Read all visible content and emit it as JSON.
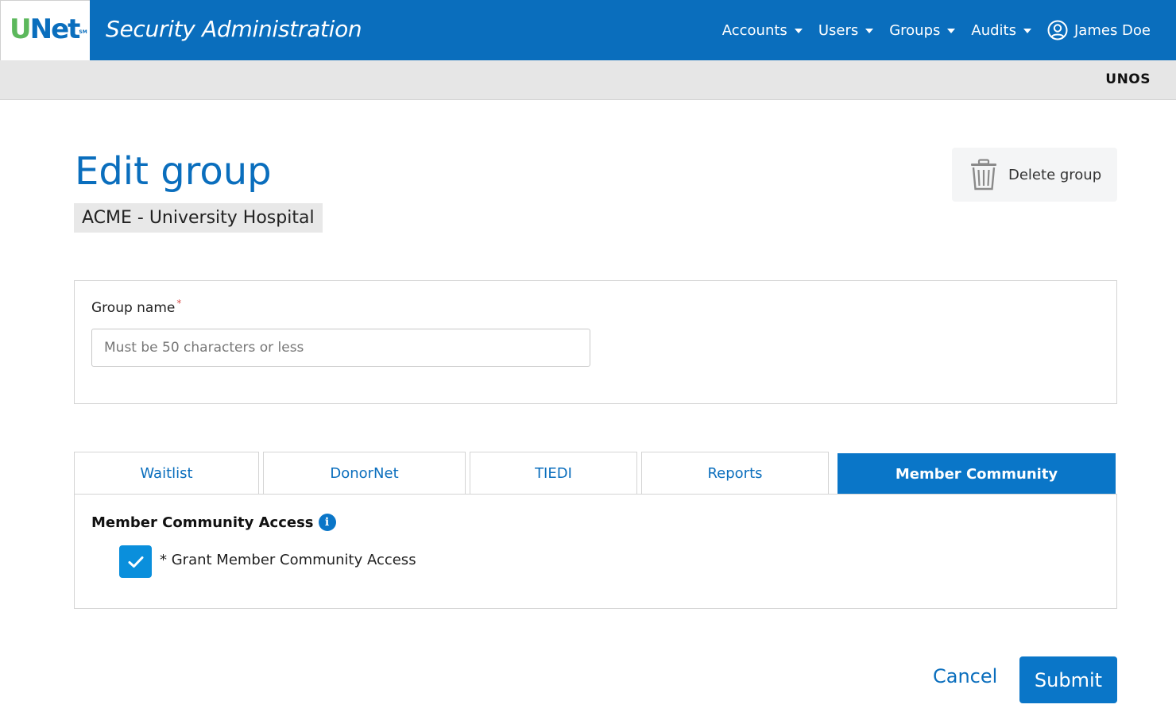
{
  "header": {
    "logo_u": "U",
    "logo_net": "Net",
    "logo_tm": "SM",
    "app_title": "Security Administration",
    "nav": [
      {
        "label": "Accounts"
      },
      {
        "label": "Users"
      },
      {
        "label": "Groups"
      },
      {
        "label": "Audits"
      }
    ],
    "user_name": "James Doe",
    "user_icon": "user-circle-icon"
  },
  "orgbar": {
    "org_name": "UNOS"
  },
  "page": {
    "title": "Edit group",
    "subtitle": "ACME - University Hospital",
    "delete_label": "Delete group",
    "delete_icon": "trash-icon"
  },
  "form": {
    "group_name_label": "Group name",
    "required_marker": "*",
    "group_name_value": "",
    "group_name_placeholder": "Must be 50 characters or less"
  },
  "tabs": [
    {
      "label": "Waitlist",
      "active": false
    },
    {
      "label": "DonorNet",
      "active": false
    },
    {
      "label": "TIEDI",
      "active": false
    },
    {
      "label": "Reports",
      "active": false
    },
    {
      "label": "Member Community",
      "active": true
    }
  ],
  "tab_panel": {
    "heading": "Member Community Access",
    "info_icon": "i",
    "checkbox_checked": true,
    "checkbox_label": "* Grant Member Community Access"
  },
  "footer": {
    "cancel_label": "Cancel",
    "submit_label": "Submit"
  },
  "colors": {
    "primary": "#0a6ebd",
    "active_tab": "#0a76c8",
    "checkbox": "#0a8fdc",
    "logo_green": "#5cb85c",
    "required": "#d9534f"
  }
}
